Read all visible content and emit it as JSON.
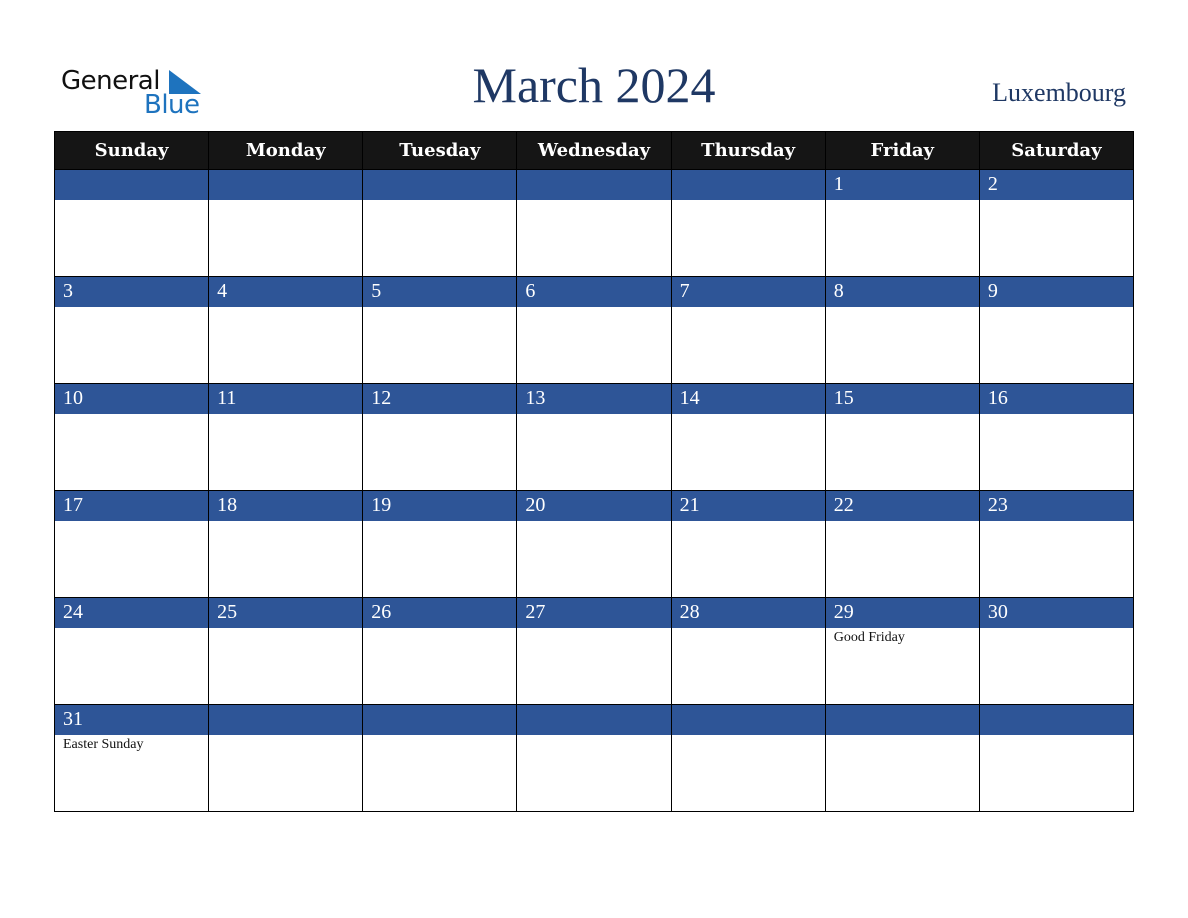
{
  "logo": {
    "word1": "General",
    "word2": "Blue",
    "accent_color": "#1e73be"
  },
  "title": "March 2024",
  "country": "Luxembourg",
  "colors": {
    "header_bg": "#151515",
    "date_bar_bg": "#2e5597",
    "title_color": "#1f3864"
  },
  "weekdays": [
    "Sunday",
    "Monday",
    "Tuesday",
    "Wednesday",
    "Thursday",
    "Friday",
    "Saturday"
  ],
  "weeks": [
    [
      {
        "day": "",
        "event": ""
      },
      {
        "day": "",
        "event": ""
      },
      {
        "day": "",
        "event": ""
      },
      {
        "day": "",
        "event": ""
      },
      {
        "day": "",
        "event": ""
      },
      {
        "day": "1",
        "event": ""
      },
      {
        "day": "2",
        "event": ""
      }
    ],
    [
      {
        "day": "3",
        "event": ""
      },
      {
        "day": "4",
        "event": ""
      },
      {
        "day": "5",
        "event": ""
      },
      {
        "day": "6",
        "event": ""
      },
      {
        "day": "7",
        "event": ""
      },
      {
        "day": "8",
        "event": ""
      },
      {
        "day": "9",
        "event": ""
      }
    ],
    [
      {
        "day": "10",
        "event": ""
      },
      {
        "day": "11",
        "event": ""
      },
      {
        "day": "12",
        "event": ""
      },
      {
        "day": "13",
        "event": ""
      },
      {
        "day": "14",
        "event": ""
      },
      {
        "day": "15",
        "event": ""
      },
      {
        "day": "16",
        "event": ""
      }
    ],
    [
      {
        "day": "17",
        "event": ""
      },
      {
        "day": "18",
        "event": ""
      },
      {
        "day": "19",
        "event": ""
      },
      {
        "day": "20",
        "event": ""
      },
      {
        "day": "21",
        "event": ""
      },
      {
        "day": "22",
        "event": ""
      },
      {
        "day": "23",
        "event": ""
      }
    ],
    [
      {
        "day": "24",
        "event": ""
      },
      {
        "day": "25",
        "event": ""
      },
      {
        "day": "26",
        "event": ""
      },
      {
        "day": "27",
        "event": ""
      },
      {
        "day": "28",
        "event": ""
      },
      {
        "day": "29",
        "event": "Good Friday"
      },
      {
        "day": "30",
        "event": ""
      }
    ],
    [
      {
        "day": "31",
        "event": "Easter Sunday"
      },
      {
        "day": "",
        "event": ""
      },
      {
        "day": "",
        "event": ""
      },
      {
        "day": "",
        "event": ""
      },
      {
        "day": "",
        "event": ""
      },
      {
        "day": "",
        "event": ""
      },
      {
        "day": "",
        "event": ""
      }
    ]
  ]
}
